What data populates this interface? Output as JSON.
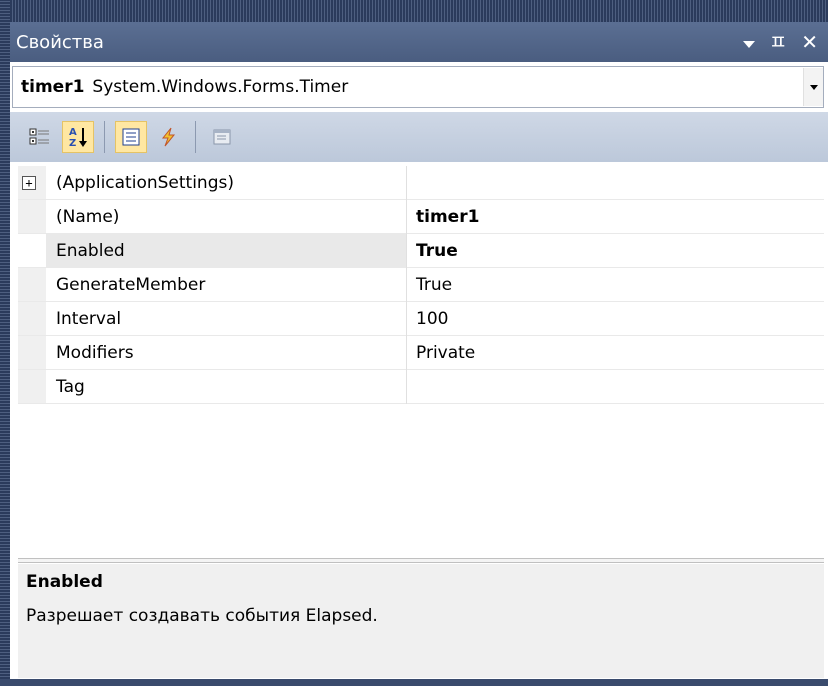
{
  "titlebar": {
    "title": "Свойства",
    "pin_glyph": "ㅍ",
    "close_glyph": "✕"
  },
  "selector": {
    "object_name": "timer1",
    "object_type": "System.Windows.Forms.Timer"
  },
  "toolbar": {
    "buttons": [
      "categorized-icon",
      "alphabetical-icon",
      "properties-icon",
      "events-icon",
      "property-pages-icon"
    ]
  },
  "properties": [
    {
      "name": "(ApplicationSettings)",
      "value": "",
      "expandable": true,
      "expander": "+"
    },
    {
      "name": "(Name)",
      "value": "timer1",
      "bold": true
    },
    {
      "name": "Enabled",
      "value": "True",
      "bold": true,
      "selected": true
    },
    {
      "name": "GenerateMember",
      "value": "True"
    },
    {
      "name": "Interval",
      "value": "100"
    },
    {
      "name": "Modifiers",
      "value": "Private"
    },
    {
      "name": "Tag",
      "value": ""
    }
  ],
  "description": {
    "title": "Enabled",
    "text": "Разрешает создавать события Elapsed."
  },
  "colors": {
    "titlebar": "#4a5d80",
    "toolbar": "#bcc8da",
    "active_button": "#ffe7a2",
    "description_bg": "#f0f0f0"
  }
}
